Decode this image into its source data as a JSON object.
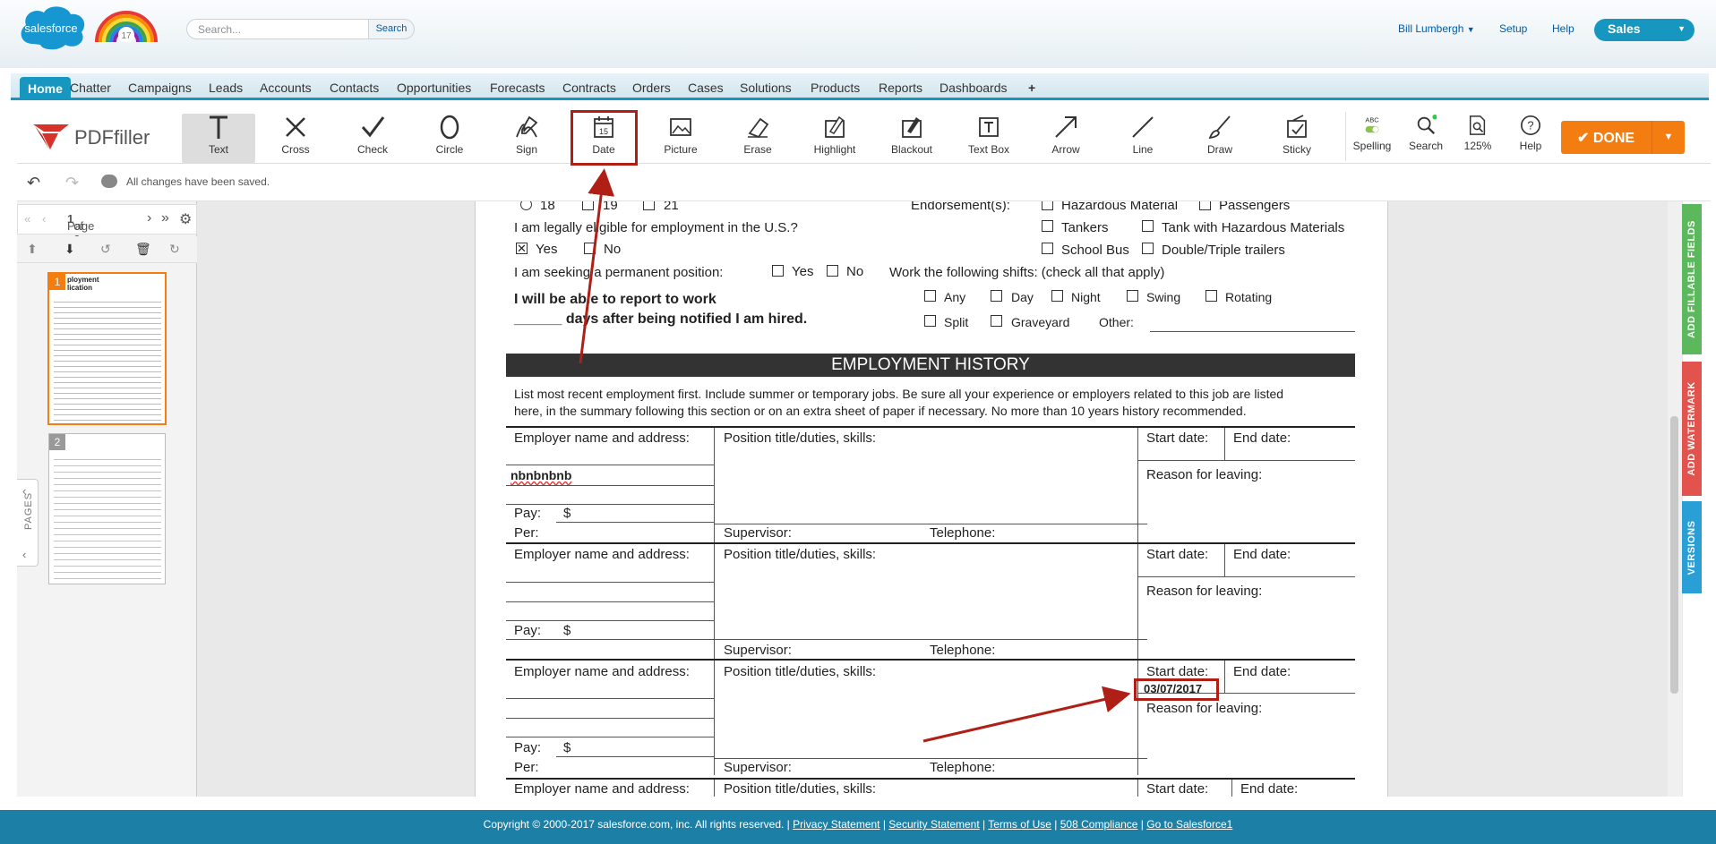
{
  "header": {
    "logo_text": "salesforce",
    "badge_number": "17",
    "search_placeholder": "Search...",
    "search_button": "Search",
    "user": "Bill Lumbergh",
    "setup": "Setup",
    "help": "Help",
    "app": "Sales"
  },
  "tabs": [
    "Home",
    "Chatter",
    "Campaigns",
    "Leads",
    "Accounts",
    "Contacts",
    "Opportunities",
    "Forecasts",
    "Contracts",
    "Orders",
    "Cases",
    "Solutions",
    "Products",
    "Reports",
    "Dashboards",
    "+"
  ],
  "pdf": {
    "logo": "PDFfiller",
    "tools": [
      "Text",
      "Cross",
      "Check",
      "Circle",
      "Sign",
      "Date",
      "Picture",
      "Erase",
      "Highlight",
      "Blackout",
      "Text Box",
      "Arrow",
      "Line",
      "Draw",
      "Sticky"
    ],
    "tools2": [
      "Spelling",
      "Search",
      "125%",
      "Help"
    ],
    "spelling_badge": "ABC",
    "done": "DONE",
    "saved": "All changes have been saved.",
    "page_label_pre": "Page",
    "page_current": "1",
    "page_label_post": "of 2",
    "thumb1": "1",
    "thumb1_title": "ployment\nlication",
    "thumb2": "2",
    "pages_tab": "PAGES"
  },
  "doc": {
    "age_18": "18",
    "age_19": "19",
    "age_21": "21",
    "endorsements": "Endorsement(s):",
    "hazmat": "Hazardous Material",
    "passengers": "Passengers",
    "tankers": "Tankers",
    "tank_hazmat": "Tank with Hazardous Materials",
    "school_bus": "School Bus",
    "double_triple": "Double/Triple trailers",
    "eligible": "I am legally eligible for employment in the U.S.?",
    "yes": "Yes",
    "no": "No",
    "seeking": "I am seeking a permanent position:",
    "shifts": "Work the following shifts: (check all that apply)",
    "any": "Any",
    "day": "Day",
    "night": "Night",
    "swing": "Swing",
    "rotating": "Rotating",
    "split": "Split",
    "graveyard": "Graveyard",
    "other": "Other:",
    "report_line1": "I will be able to report to work",
    "report_line2": "______ days after being notified I am hired.",
    "banner": "EMPLOYMENT HISTORY",
    "intro1": "List most recent employment first. Include summer or temporary jobs. Be sure all your experience or employers related to this job are listed",
    "intro2": "here, in the summary following this section or on an extra sheet of paper if necessary. No more than 10 years history recommended.",
    "employer": "Employer name and address:",
    "position": "Position title/duties, skills:",
    "start": "Start date:",
    "end": "End date:",
    "reason": "Reason for leaving:",
    "pay": "Pay:",
    "dollar": "$",
    "per": "Per:",
    "supervisor": "Supervisor:",
    "telephone": "Telephone:",
    "filled_name": "nbnbnbnb",
    "filled_date": "03/07/2017"
  },
  "sidebar_tabs": [
    "ADD FILLABLE FIELDS",
    "ADD WATERMARK",
    "VERSIONS"
  ],
  "footer": {
    "copyright": "Copyright © 2000-2017 salesforce.com, inc. All rights reserved. |",
    "links": [
      "Privacy Statement",
      "Security Statement",
      "Terms of Use",
      "508 Compliance",
      "Go to Salesforce1"
    ]
  },
  "colors": {
    "accent": "#1797c0",
    "done": "#f47d12",
    "annotation": "#b01f16"
  }
}
